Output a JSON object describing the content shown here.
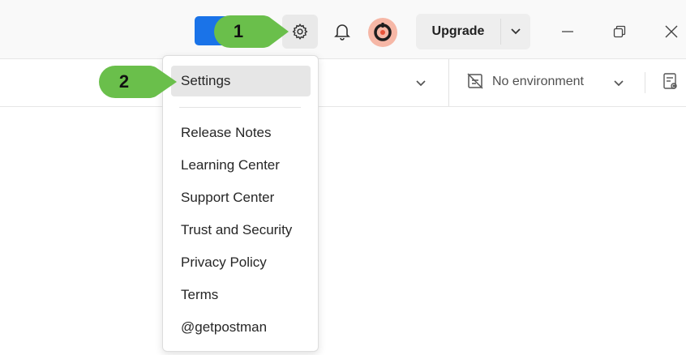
{
  "titlebar": {
    "upgrade_label": "Upgrade",
    "icons": [
      "settings-icon",
      "bell-icon",
      "avatar-icon",
      "chevron-down-icon",
      "minimize-icon",
      "restore-icon",
      "close-icon"
    ]
  },
  "toolbar": {
    "environment_label": "No environment"
  },
  "menu": {
    "items": [
      {
        "label": "Settings"
      },
      {
        "label": "Release Notes"
      },
      {
        "label": "Learning Center"
      },
      {
        "label": "Support Center"
      },
      {
        "label": "Trust and Security"
      },
      {
        "label": "Privacy Policy"
      },
      {
        "label": "Terms"
      },
      {
        "label": "@getpostman"
      }
    ]
  },
  "callouts": [
    {
      "number": "1"
    },
    {
      "number": "2"
    }
  ],
  "colors": {
    "callout_green": "#6abf4b",
    "blue_button": "#1a73e8",
    "avatar_ring": "#f6b7a6",
    "menu_highlight": "#e6e6e6"
  }
}
